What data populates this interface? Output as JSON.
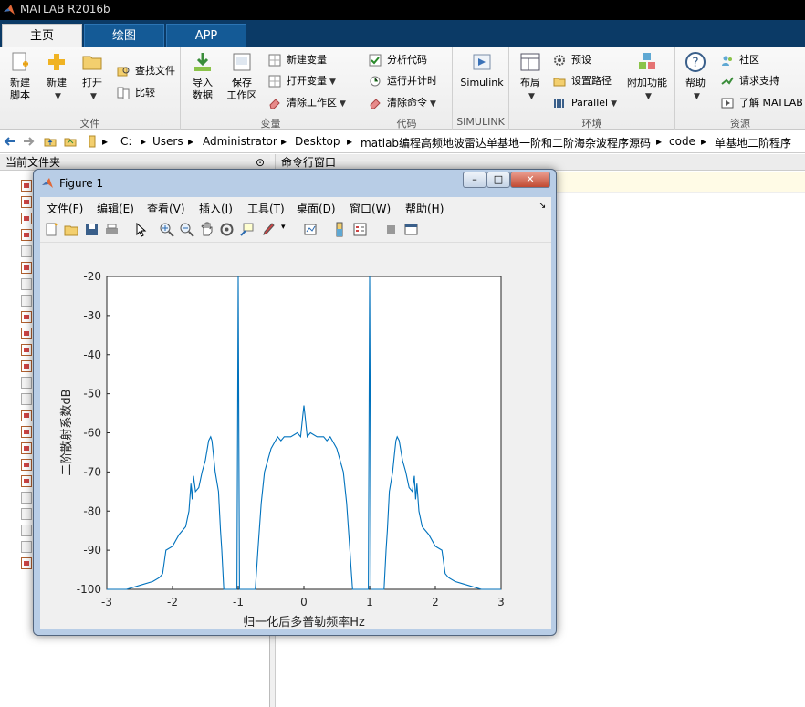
{
  "window_title": "MATLAB R2016b",
  "tabs": [
    "主页",
    "绘图",
    "APP"
  ],
  "ribbon": {
    "new_script": "新建\n脚本",
    "new": "新建",
    "open": "打开",
    "find_files": "查找文件",
    "compare": "比较",
    "import_data": "导入\n数据",
    "save_workspace": "保存\n工作区",
    "new_variable": "新建变量",
    "open_variable": "打开变量",
    "clear_workspace": "清除工作区",
    "analyze_code": "分析代码",
    "run_and_time": "运行并计时",
    "clear_commands": "清除命令",
    "simulink": "Simulink",
    "layout": "布局",
    "preferences": "预设",
    "set_path": "设置路径",
    "parallel": "Parallel",
    "addons": "附加功能",
    "help": "帮助",
    "community": "社区",
    "request_support": "请求支持",
    "learn_matlab": "了解 MATLAB",
    "groups": [
      "文件",
      "变量",
      "代码",
      "SIMULINK",
      "环境",
      "资源"
    ]
  },
  "address": [
    "C:",
    "Users",
    "Administrator",
    "Desktop",
    "matlab编程高频地波雷达单基地一阶和二阶海杂波程序源码",
    "code",
    "单基地二阶程序"
  ],
  "left_panel": {
    "title": "当前文件夹"
  },
  "right_panel": {
    "title": "命令行窗口"
  },
  "figure": {
    "title": "Figure 1",
    "menus": [
      "文件(F)",
      "编辑(E)",
      "查看(V)",
      "插入(I)",
      "工具(T)",
      "桌面(D)",
      "窗口(W)",
      "帮助(H)"
    ]
  },
  "chart_data": {
    "type": "line",
    "title": "",
    "xlabel": "归一化后多普勒频率Hz",
    "ylabel": "二阶散射系数dB",
    "xlim": [
      -3,
      3
    ],
    "ylim": [
      -100,
      -20
    ],
    "xticks": [
      -3,
      -2,
      -1,
      0,
      1,
      2,
      3
    ],
    "yticks": [
      -20,
      -30,
      -40,
      -50,
      -60,
      -70,
      -80,
      -90,
      -100
    ],
    "color": "#0072bd",
    "series": [
      {
        "x": [
          -3,
          -2.7,
          -2.5,
          -2.3,
          -2.2,
          -2.15,
          -2.1,
          -2.0,
          -1.9,
          -1.8,
          -1.75,
          -1.72,
          -1.7,
          -1.68,
          -1.65,
          -1.6,
          -1.55,
          -1.5,
          -1.45,
          -1.42,
          -1.4,
          -1.38,
          -1.35,
          -1.3,
          -1.27,
          -1.25,
          -1.22,
          -1.15,
          -1.1,
          -1.05,
          -1.02,
          -1.01,
          -1.0,
          -0.99,
          -0.98,
          -0.96,
          -0.8,
          -0.74,
          -0.72,
          -0.7,
          -0.65,
          -0.6,
          -0.5,
          -0.4,
          -0.35,
          -0.3,
          -0.2,
          -0.1,
          -0.05,
          -0.02,
          0,
          0.02,
          0.05,
          0.1,
          0.2,
          0.3,
          0.35,
          0.4,
          0.5,
          0.6,
          0.65,
          0.7,
          0.72,
          0.74,
          0.8,
          0.96,
          0.98,
          0.99,
          1.0,
          1.01,
          1.02,
          1.05,
          1.1,
          1.15,
          1.22,
          1.25,
          1.27,
          1.3,
          1.35,
          1.38,
          1.4,
          1.42,
          1.45,
          1.5,
          1.55,
          1.6,
          1.65,
          1.68,
          1.7,
          1.72,
          1.75,
          1.8,
          1.9,
          2.0,
          2.1,
          2.15,
          2.2,
          2.3,
          2.5,
          2.7,
          3
        ],
        "y": [
          -100,
          -100,
          -99,
          -98,
          -97,
          -96,
          -90,
          -89,
          -86,
          -84,
          -80,
          -73,
          -77,
          -71,
          -75,
          -74,
          -70,
          -67,
          -62,
          -61,
          -62,
          -65,
          -70,
          -75,
          -85,
          -90,
          -100,
          -100,
          -100,
          -100,
          -100,
          -60,
          -20,
          -60,
          -100,
          -100,
          -100,
          -100,
          -95,
          -90,
          -78,
          -70,
          -64,
          -61,
          -62,
          -61,
          -61,
          -60,
          -61,
          -56,
          -53,
          -56,
          -61,
          -60,
          -61,
          -61,
          -62,
          -61,
          -64,
          -70,
          -78,
          -90,
          -95,
          -100,
          -100,
          -100,
          -100,
          -60,
          -20,
          -60,
          -100,
          -100,
          -100,
          -100,
          -100,
          -90,
          -85,
          -75,
          -70,
          -65,
          -62,
          -61,
          -62,
          -67,
          -70,
          -74,
          -75,
          -71,
          -77,
          -73,
          -80,
          -84,
          -86,
          -89,
          -90,
          -96,
          -97,
          -98,
          -99,
          -100,
          -100
        ]
      }
    ]
  }
}
